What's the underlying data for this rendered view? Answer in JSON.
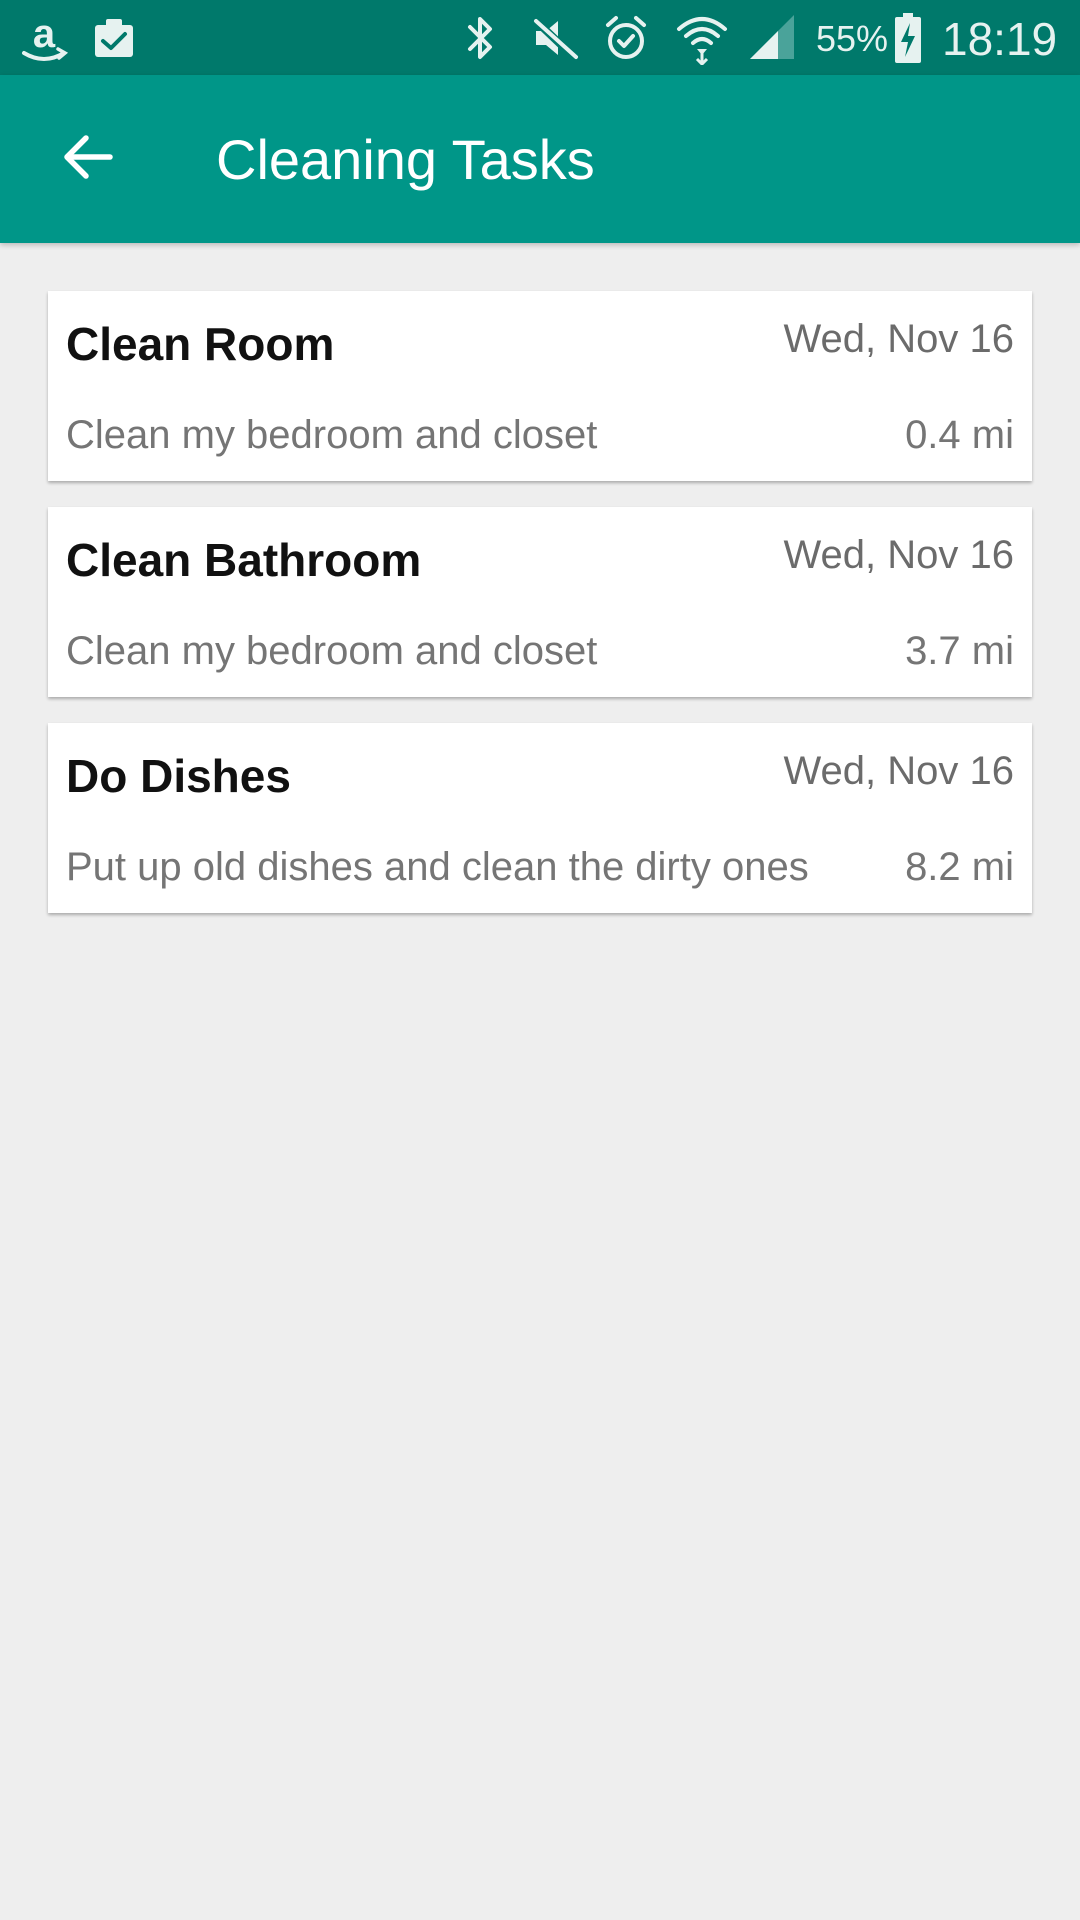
{
  "status_bar": {
    "battery_percent": "55%",
    "time": "18:19",
    "icons": [
      "amazon-icon",
      "clipboard-check-icon",
      "bluetooth-icon",
      "mute-icon",
      "alarm-icon",
      "wifi-icon",
      "signal-icon",
      "battery-charging-icon"
    ],
    "background_color": "#00796b"
  },
  "app_bar": {
    "title": "Cleaning Tasks",
    "back_icon": "arrow-back-icon",
    "background_color": "#009688"
  },
  "tasks": [
    {
      "title": "Clean Room",
      "date": "Wed, Nov 16",
      "description": "Clean my bedroom and closet",
      "distance": "0.4 mi"
    },
    {
      "title": "Clean Bathroom",
      "date": "Wed, Nov 16",
      "description": "Clean my bedroom and closet",
      "distance": "3.7 mi"
    },
    {
      "title": "Do Dishes",
      "date": "Wed, Nov 16",
      "description": "Put up old dishes and clean the dirty ones",
      "distance": "8.2 mi"
    }
  ]
}
